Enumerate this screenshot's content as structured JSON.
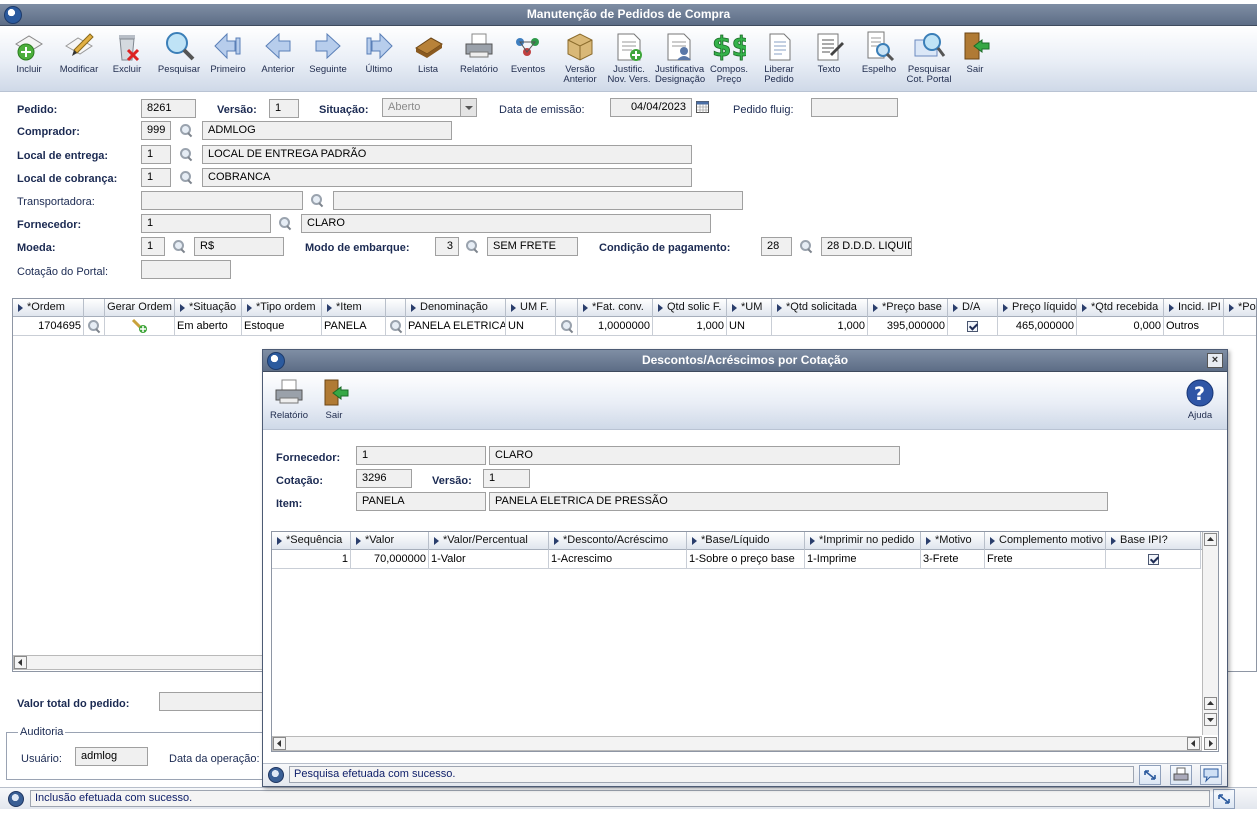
{
  "window": {
    "title": "Manutenção de Pedidos de Compra"
  },
  "toolbar": {
    "incluir": "Incluir",
    "modificar": "Modificar",
    "excluir": "Excluir",
    "pesquisar": "Pesquisar",
    "primeiro": "Primeiro",
    "anterior": "Anterior",
    "seguinte": "Seguinte",
    "ultimo": "Último",
    "lista": "Lista",
    "relatorio": "Relatório",
    "eventos": "Eventos",
    "versao_anterior": "Versão\nAnterior",
    "justific_nov_vers": "Justific.\nNov. Vers.",
    "justificativa_designacao": "Justificativa\nDesignação",
    "compos_preco": "Compos.\nPreço",
    "liberar_pedido": "Liberar\nPedido",
    "texto": "Texto",
    "espelho": "Espelho",
    "pesquisar_cot_portal": "Pesquisar\nCot. Portal",
    "sair": "Sair"
  },
  "form": {
    "pedido_label": "Pedido:",
    "pedido": "8261",
    "versao_label": "Versão:",
    "versao": "1",
    "situacao_label": "Situação:",
    "situacao": "Aberto",
    "data_emissao_label": "Data de emissão:",
    "data_emissao": "04/04/2023",
    "pedido_fluig_label": "Pedido fluig:",
    "pedido_fluig": "",
    "comprador_label": "Comprador:",
    "comprador_cod": "999",
    "comprador_nome": "ADMLOG",
    "local_entrega_label": "Local de entrega:",
    "local_entrega_cod": "1",
    "local_entrega_nome": "LOCAL DE ENTREGA PADRÃO",
    "local_cobranca_label": "Local de cobrança:",
    "local_cobranca_cod": "1",
    "local_cobranca_nome": "COBRANCA",
    "transportadora_label": "Transportadora:",
    "transportadora_cod": "",
    "transportadora_nome": "",
    "fornecedor_label": "Fornecedor:",
    "fornecedor_cod": "1",
    "fornecedor_nome": "CLARO",
    "moeda_label": "Moeda:",
    "moeda_cod": "1",
    "moeda_nome": "R$",
    "modo_embarque_label": "Modo de embarque:",
    "modo_embarque_cod": "3",
    "modo_embarque_nome": "SEM FRETE",
    "cond_pagamento_label": "Condição de pagamento:",
    "cond_pagamento_cod": "28",
    "cond_pagamento_nome": "28 D.D.D. LIQUID",
    "cotacao_portal_label": "Cotação do Portal:",
    "cotacao_portal": ""
  },
  "items_grid": {
    "headers": [
      "*Ordem",
      "",
      "Gerar Ordem",
      "*Situação",
      "*Tipo ordem",
      "*Item",
      "",
      "Denominação",
      "UM F.",
      "",
      "*Fat. conv.",
      "Qtd solic F.",
      "*UM",
      "*Qtd solicitada",
      "*Preço base",
      "D/A",
      "Preço líquido",
      "*Qtd recebida",
      "Incid. IPI",
      "*Po"
    ],
    "row": {
      "ordem": "1704695",
      "situacao": "Em aberto",
      "tipo_ordem": "Estoque",
      "item": "PANELA",
      "denominacao": "PANELA ELETRICA",
      "um_f": "UN",
      "fat_conv": "1,0000000",
      "qtd_solic_f": "1,000",
      "um": "UN",
      "qtd_solicitada": "1,000",
      "preco_base": "395,000000",
      "preco_liquido": "465,000000",
      "qtd_recebida": "0,000",
      "incid_ipi": "Outros"
    }
  },
  "footer": {
    "valor_total_label": "Valor total do pedido:",
    "valor_total": "",
    "auditoria_label": "Auditoria",
    "usuario_label": "Usuário:",
    "usuario": "admlog",
    "data_operacao_label": "Data da operação:"
  },
  "status": {
    "message": "Inclusão efetuada com sucesso."
  },
  "dialog": {
    "title": "Descontos/Acréscimos por Cotação",
    "relatorio": "Relatório",
    "sair": "Sair",
    "ajuda": "Ajuda",
    "fornecedor_label": "Fornecedor:",
    "fornecedor_cod": "1",
    "fornecedor_nome": "CLARO",
    "cotacao_label": "Cotação:",
    "cotacao": "3296",
    "versao_label": "Versão:",
    "versao": "1",
    "item_label": "Item:",
    "item_cod": "PANELA",
    "item_nome": "PANELA ELETRICA DE PRESSÃO",
    "grid_headers": [
      "*Sequência",
      "*Valor",
      "*Valor/Percentual",
      "*Desconto/Acréscimo",
      "*Base/Líquido",
      "*Imprimir no pedido",
      "*Motivo",
      "Complemento motivo",
      "Base IPI?"
    ],
    "row": {
      "sequencia": "1",
      "valor": "70,000000",
      "valor_percentual": "1-Valor",
      "desconto_acrescimo": "1-Acrescimo",
      "base_liquido": "1-Sobre o preço base",
      "imprimir": "1-Imprime",
      "motivo": "3-Frete",
      "complemento": "Frete"
    },
    "status_message": "Pesquisa efetuada com sucesso."
  },
  "colors": {
    "titlebar": "#6b7a92",
    "accent": "#2b5a9e",
    "status_text": "#10206a"
  }
}
